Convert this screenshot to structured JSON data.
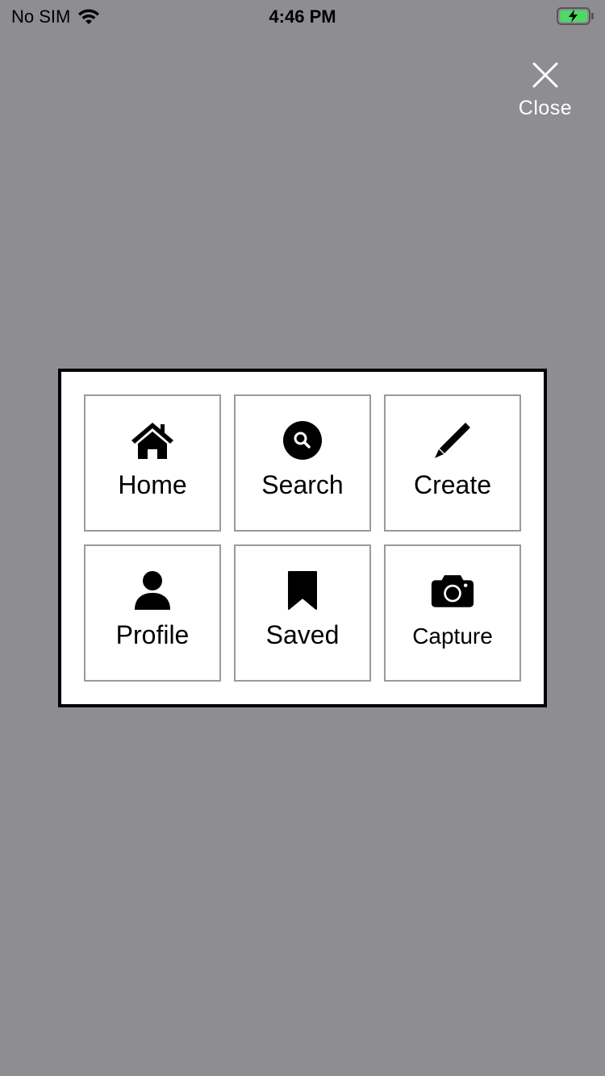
{
  "status_bar": {
    "carrier": "No SIM",
    "time": "4:46 PM",
    "battery_color": "#4cd964"
  },
  "close": {
    "label": "Close",
    "icon": "close-icon"
  },
  "menu": {
    "items": [
      {
        "label": "Home",
        "icon": "home-icon"
      },
      {
        "label": "Search",
        "icon": "search-icon"
      },
      {
        "label": "Create",
        "icon": "pencil-icon"
      },
      {
        "label": "Profile",
        "icon": "user-icon"
      },
      {
        "label": "Saved",
        "icon": "bookmark-icon"
      },
      {
        "label": "Capture",
        "icon": "camera-icon"
      }
    ]
  }
}
